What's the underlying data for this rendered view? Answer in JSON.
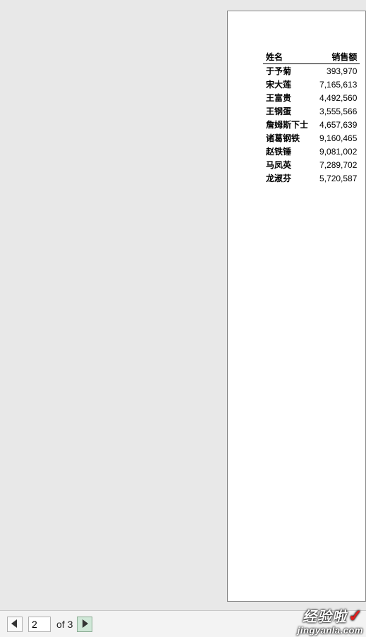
{
  "table": {
    "headers": [
      "姓名",
      "销售额"
    ],
    "rows": [
      {
        "name": "于予菊",
        "value": "393,970"
      },
      {
        "name": "宋大莲",
        "value": "7,165,613"
      },
      {
        "name": "王富贵",
        "value": "4,492,560"
      },
      {
        "name": "王钢蛋",
        "value": "3,555,566"
      },
      {
        "name": "詹姆斯下士",
        "value": "4,657,639"
      },
      {
        "name": "诸葛钢铁",
        "value": "9,160,465"
      },
      {
        "name": "赵铁锤",
        "value": "9,081,002"
      },
      {
        "name": "马凤英",
        "value": "7,289,702"
      },
      {
        "name": "龙淑芬",
        "value": "5,720,587"
      }
    ]
  },
  "pager": {
    "current": "2",
    "of_label": "of",
    "total": "3"
  },
  "watermark": {
    "line1": "经验啦",
    "check": "✓",
    "line2": "jingyanla.com"
  }
}
